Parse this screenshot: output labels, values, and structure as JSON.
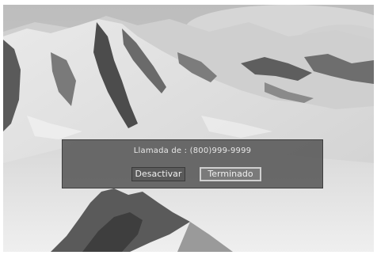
{
  "dialog": {
    "caller_text": "Llamada de : (800)999-9999",
    "buttons": {
      "deactivate_label": "Desactivar",
      "done_label": "Terminado"
    },
    "selected_button": "Terminado"
  },
  "background": {
    "scene": "mountain-photo"
  }
}
